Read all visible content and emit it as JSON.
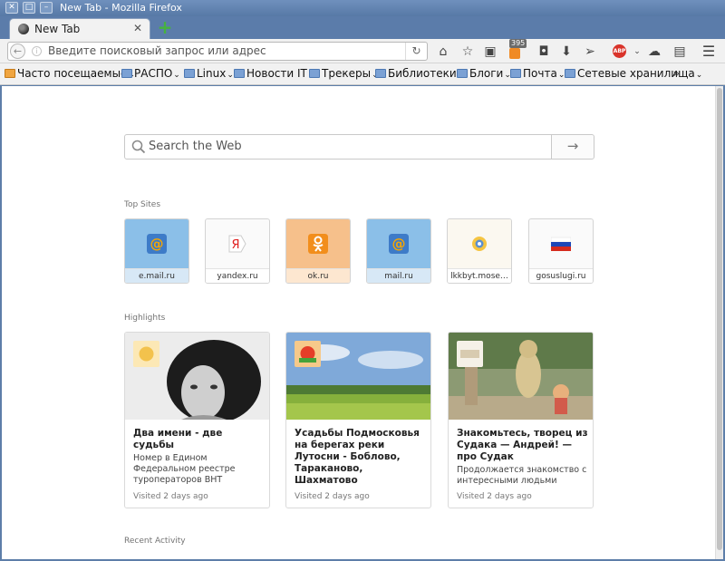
{
  "window": {
    "title": "New Tab - Mozilla Firefox"
  },
  "tab": {
    "label": "New Tab",
    "close": "✕"
  },
  "newtab": {
    "label": "+"
  },
  "navbar": {
    "placeholder": "Введите поисковый запрос или адрес",
    "feed_badge": "395"
  },
  "bookmarks": [
    {
      "label": "Часто посещаемые",
      "icon": "orange-folder-icon"
    },
    {
      "label": "РАСПО"
    },
    {
      "label": "Linux"
    },
    {
      "label": "Новости IT"
    },
    {
      "label": "Трекеры"
    },
    {
      "label": "Библиотеки"
    },
    {
      "label": "Блоги"
    },
    {
      "label": "Почта"
    },
    {
      "label": "Сетевые хранилища"
    }
  ],
  "bookmarks_overflow": "»",
  "search": {
    "placeholder": "Search the Web",
    "go": "→"
  },
  "top_sites": {
    "title": "Top Sites",
    "items": [
      {
        "label": "e.mail.ru",
        "icon": "mailru-icon"
      },
      {
        "label": "yandex.ru",
        "icon": "yandex-icon"
      },
      {
        "label": "ok.ru",
        "icon": "odnoklassniki-icon"
      },
      {
        "label": "mail.ru",
        "icon": "mailru-icon"
      },
      {
        "label": "lkkbyt.mose…",
        "icon": "sun-emblem-icon"
      },
      {
        "label": "gosuslugi.ru",
        "icon": "russian-flag-icon"
      }
    ]
  },
  "highlights": {
    "title": "Highlights",
    "cards": [
      {
        "title": "Два имени - две судьбы",
        "desc": "Номер в Едином Федеральном реестре туроператоров ВНТ",
        "meta": "Visited 2 days ago"
      },
      {
        "title": "Усадьбы Подмосковья на берегах реки Лутосни - Боблово, Тараканово, Шахматово",
        "desc": "",
        "meta": "Visited 2 days ago"
      },
      {
        "title": "Знакомьтесь, творец из Судака — Андрей! — про Судак",
        "desc": "Продолжается знакомство с интересными людьми",
        "meta": "Visited 2 days ago"
      }
    ]
  },
  "recent_activity": {
    "title": "Recent Activity"
  }
}
